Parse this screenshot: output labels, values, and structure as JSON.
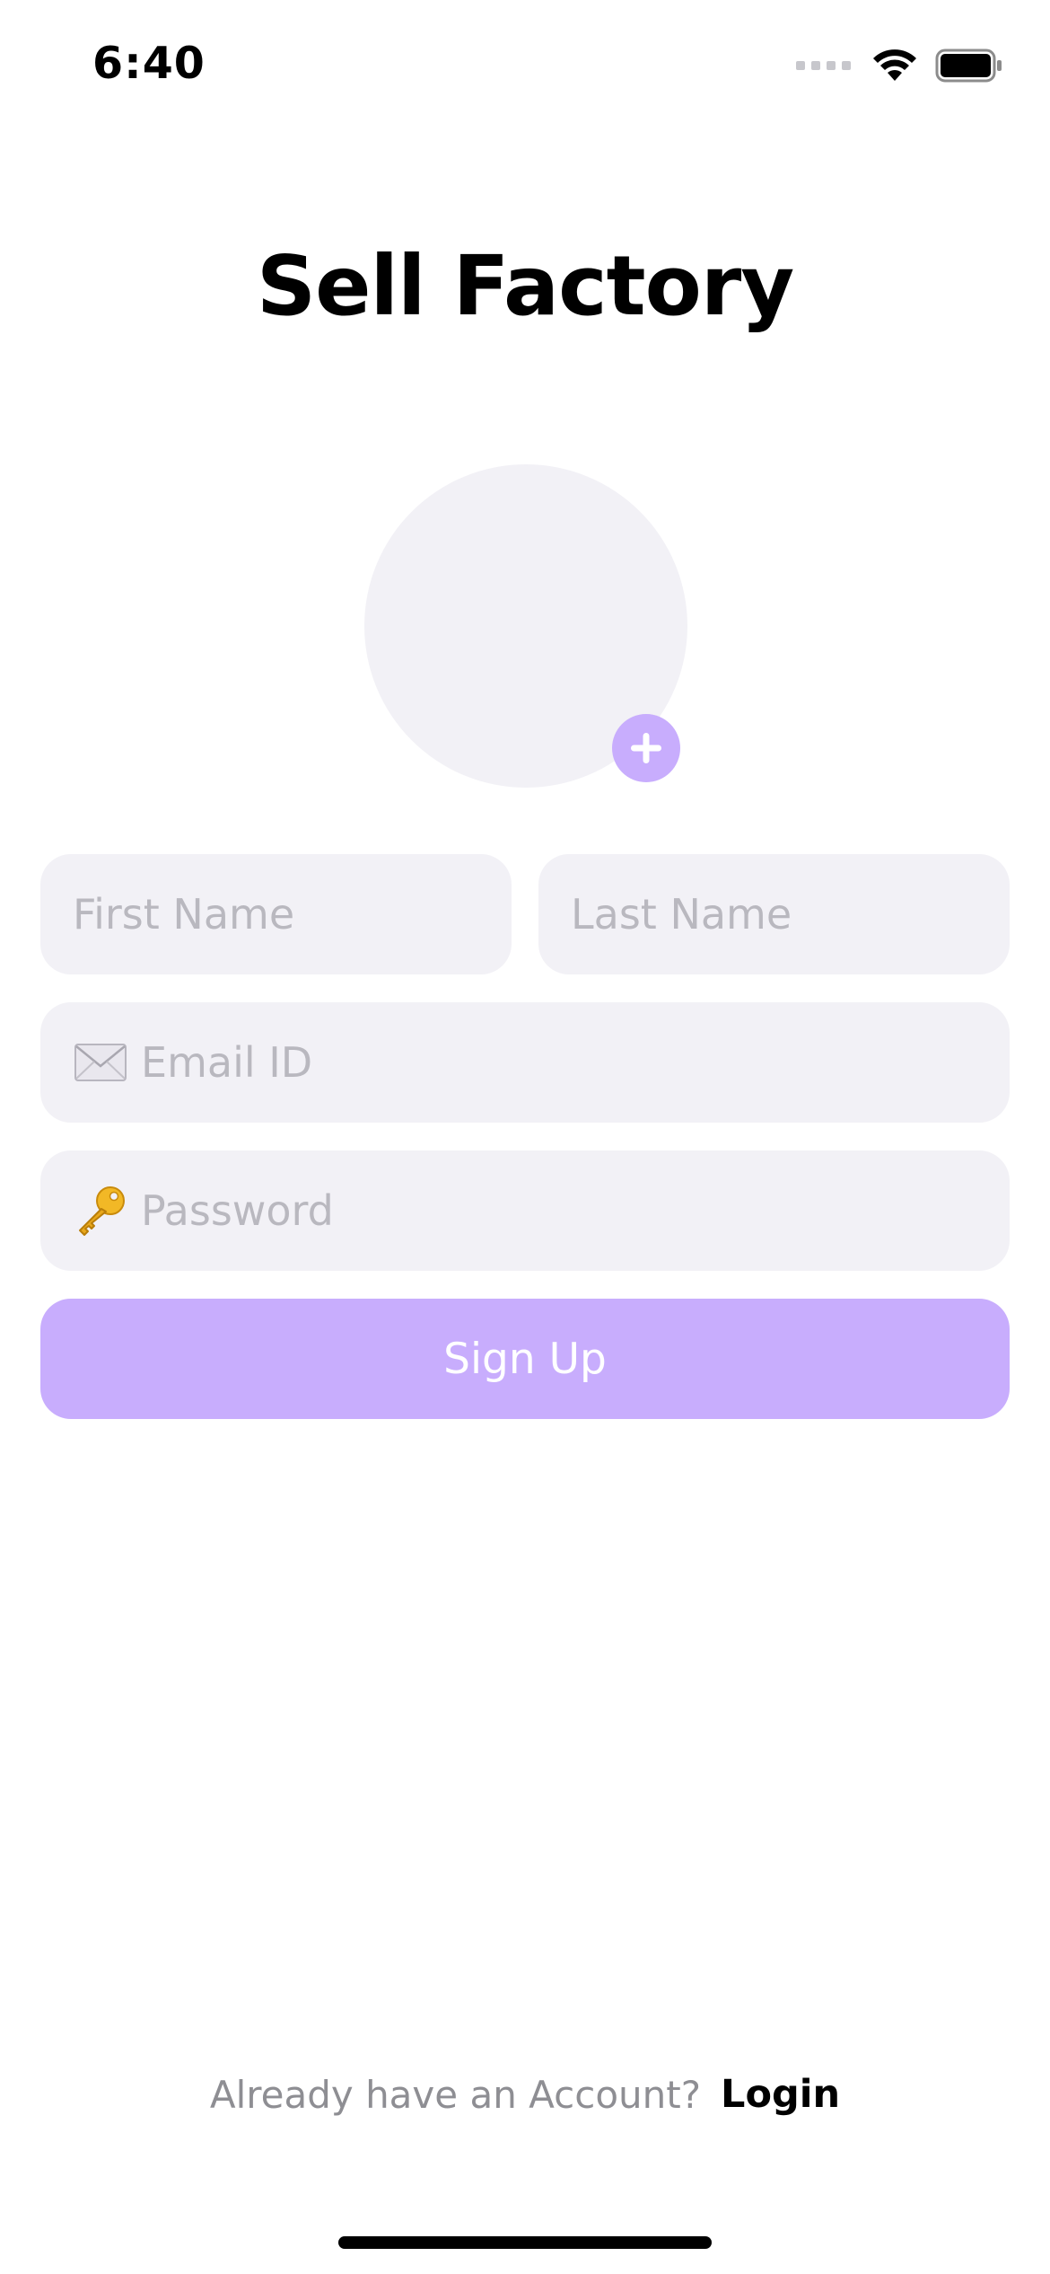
{
  "status_bar": {
    "time": "6:40",
    "icons": [
      "cellular-signal-icon",
      "wifi-icon",
      "battery-icon"
    ]
  },
  "header": {
    "title": "Sell Factory"
  },
  "avatar": {
    "add_icon": "plus-icon",
    "add_color": "#c8adfd"
  },
  "form": {
    "first_name": {
      "placeholder": "First Name",
      "value": ""
    },
    "last_name": {
      "placeholder": "Last Name",
      "value": ""
    },
    "email": {
      "placeholder": "Email ID",
      "value": "",
      "icon": "envelope-icon"
    },
    "password": {
      "placeholder": "Password",
      "value": "",
      "icon": "key-icon"
    },
    "submit_label": "Sign Up"
  },
  "footer": {
    "prompt": "Already have an Account?",
    "login_label": "Login"
  },
  "colors": {
    "accent": "#c8adfd",
    "field_background": "#f2f1f6",
    "placeholder": "#b9b8bf",
    "secondary_text": "#8e8e93"
  }
}
